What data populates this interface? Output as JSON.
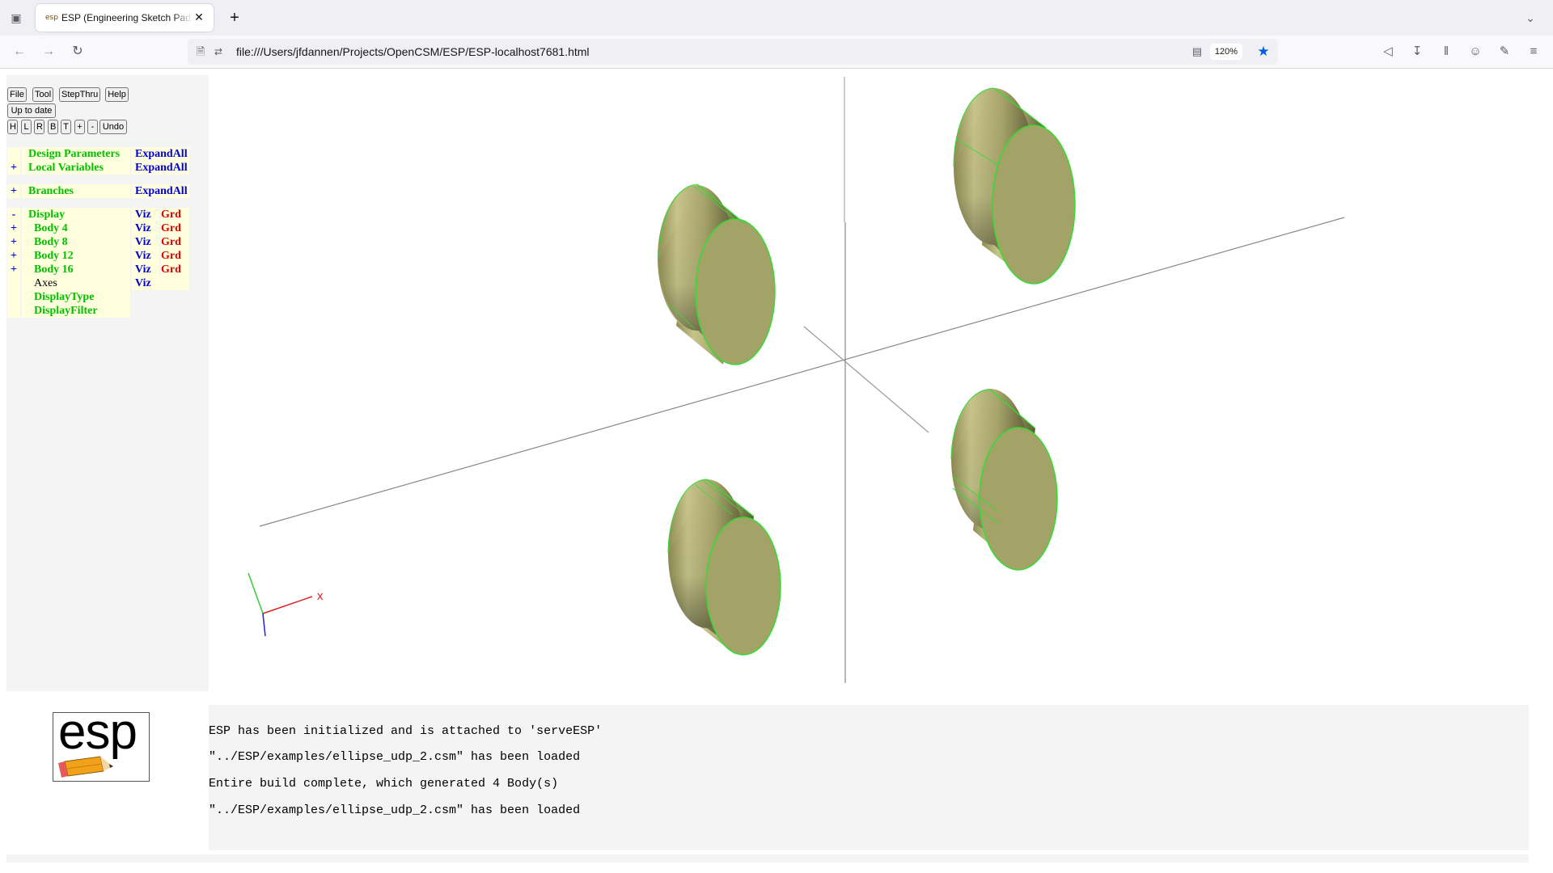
{
  "browser": {
    "tab_title": "ESP (Engineering Sketch Pad, V",
    "favicon_text": "esp",
    "url": "file:///Users/jfdannen/Projects/OpenCSM/ESP/ESP-localhost7681.html",
    "zoom": "120%",
    "icons": {
      "tab_list": "tab-list-icon",
      "close": "close-icon",
      "new_tab": "plus-icon",
      "back": "back-arrow-icon",
      "forward": "forward-arrow-icon",
      "reload": "reload-icon",
      "page": "page-icon",
      "permissions": "permissions-icon",
      "reader": "reader-view-icon",
      "bookmark": "star-icon",
      "pocket": "pocket-icon",
      "downloads": "download-icon",
      "library": "library-icon",
      "account": "account-icon",
      "extensions": "extensions-icon",
      "menu": "hamburger-menu-icon"
    },
    "accent_color": "#0061e0"
  },
  "toolbar": {
    "file": "File",
    "tool": "Tool",
    "stepthru": "StepThru",
    "help": "Help",
    "status": "Up to date",
    "view_h": "H",
    "view_l": "L",
    "view_r": "R",
    "view_b": "B",
    "view_t": "T",
    "zoom_in": "+",
    "zoom_out": "-",
    "undo": "Undo"
  },
  "tree": {
    "design_parameters": {
      "label": "Design Parameters",
      "action": "ExpandAll"
    },
    "local_variables": {
      "toggle": "+",
      "label": "Local Variables",
      "action": "ExpandAll"
    },
    "branches": {
      "toggle": "+",
      "label": "Branches",
      "action": "ExpandAll"
    },
    "display": {
      "toggle": "-",
      "label": "Display",
      "viz": "Viz",
      "grd": "Grd"
    },
    "bodies": [
      {
        "toggle": "+",
        "label": "Body 4",
        "viz": "Viz",
        "grd": "Grd"
      },
      {
        "toggle": "+",
        "label": "Body 8",
        "viz": "Viz",
        "grd": "Grd"
      },
      {
        "toggle": "+",
        "label": "Body 12",
        "viz": "Viz",
        "grd": "Grd"
      },
      {
        "toggle": "+",
        "label": "Body 16",
        "viz": "Viz",
        "grd": "Grd"
      }
    ],
    "axes": {
      "label": "Axes",
      "viz": "Viz"
    },
    "display_type": {
      "label": "DisplayType"
    },
    "display_filter": {
      "label": "DisplayFilter"
    },
    "colors": {
      "label": "#00c000",
      "action": "#0000dd",
      "grd": "#dd0000"
    }
  },
  "viewer": {
    "body_face_color": "#a3a267",
    "edge_color": "#33dd33",
    "axis_triad": {
      "x_label": "x"
    }
  },
  "logo": {
    "text": "esp"
  },
  "messages": [
    "ESP has been initialized and is attached to 'serveESP'",
    "\"../ESP/examples/ellipse_udp_2.csm\" has been loaded",
    "Entire build complete, which generated 4 Body(s)",
    "\"../ESP/examples/ellipse_udp_2.csm\" has been loaded"
  ]
}
